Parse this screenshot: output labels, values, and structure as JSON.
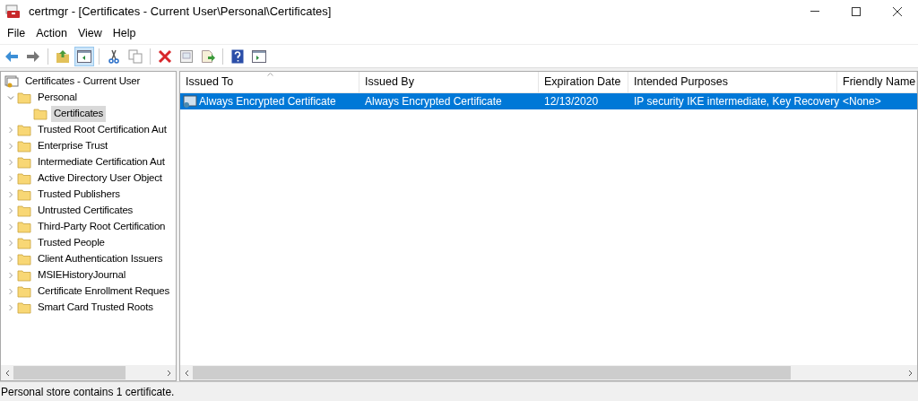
{
  "window": {
    "title": "certmgr - [Certificates - Current User\\Personal\\Certificates]"
  },
  "menu": [
    "File",
    "Action",
    "View",
    "Help"
  ],
  "toolbar": [
    {
      "kind": "back",
      "pressed": false
    },
    {
      "kind": "forward",
      "pressed": false
    },
    {
      "kind": "sep"
    },
    {
      "kind": "up",
      "pressed": false
    },
    {
      "kind": "tree",
      "pressed": true
    },
    {
      "kind": "sep"
    },
    {
      "kind": "cut",
      "pressed": false
    },
    {
      "kind": "copy",
      "pressed": false
    },
    {
      "kind": "sep"
    },
    {
      "kind": "delete",
      "pressed": false
    },
    {
      "kind": "properties",
      "pressed": false
    },
    {
      "kind": "export",
      "pressed": false
    },
    {
      "kind": "sep"
    },
    {
      "kind": "help",
      "pressed": false
    },
    {
      "kind": "pane",
      "pressed": false
    }
  ],
  "tree": {
    "label": "Certificates - Current User",
    "selected": false,
    "children": [
      {
        "label": "Personal",
        "selected": false,
        "expanded": true,
        "children": [
          {
            "label": "Certificates",
            "selected": true
          }
        ]
      },
      {
        "label": "Trusted Root Certification Aut",
        "selected": false,
        "expanded": false
      },
      {
        "label": "Enterprise Trust",
        "selected": false,
        "expanded": false
      },
      {
        "label": "Intermediate Certification Aut",
        "selected": false,
        "expanded": false
      },
      {
        "label": "Active Directory User Object",
        "selected": false,
        "expanded": false
      },
      {
        "label": "Trusted Publishers",
        "selected": false,
        "expanded": false
      },
      {
        "label": "Untrusted Certificates",
        "selected": false,
        "expanded": false
      },
      {
        "label": "Third-Party Root Certification",
        "selected": false,
        "expanded": false
      },
      {
        "label": "Trusted People",
        "selected": false,
        "expanded": false
      },
      {
        "label": "Client Authentication Issuers",
        "selected": false,
        "expanded": false
      },
      {
        "label": "MSIEHistoryJournal",
        "selected": false,
        "expanded": false
      },
      {
        "label": "Certificate Enrollment Reques",
        "selected": false,
        "expanded": false
      },
      {
        "label": "Smart Card Trusted Roots",
        "selected": false,
        "expanded": false
      }
    ]
  },
  "table": {
    "columns": [
      "Issued To",
      "Issued By",
      "Expiration Date",
      "Intended Purposes",
      "Friendly Name"
    ],
    "rows": [
      {
        "cells": [
          "Always Encrypted Certificate",
          "Always Encrypted Certificate",
          "12/13/2020",
          "IP security IKE intermediate, Key Recovery",
          "<None>"
        ],
        "selected": true
      }
    ]
  },
  "status_bar": "Personal store contains 1 certificate."
}
